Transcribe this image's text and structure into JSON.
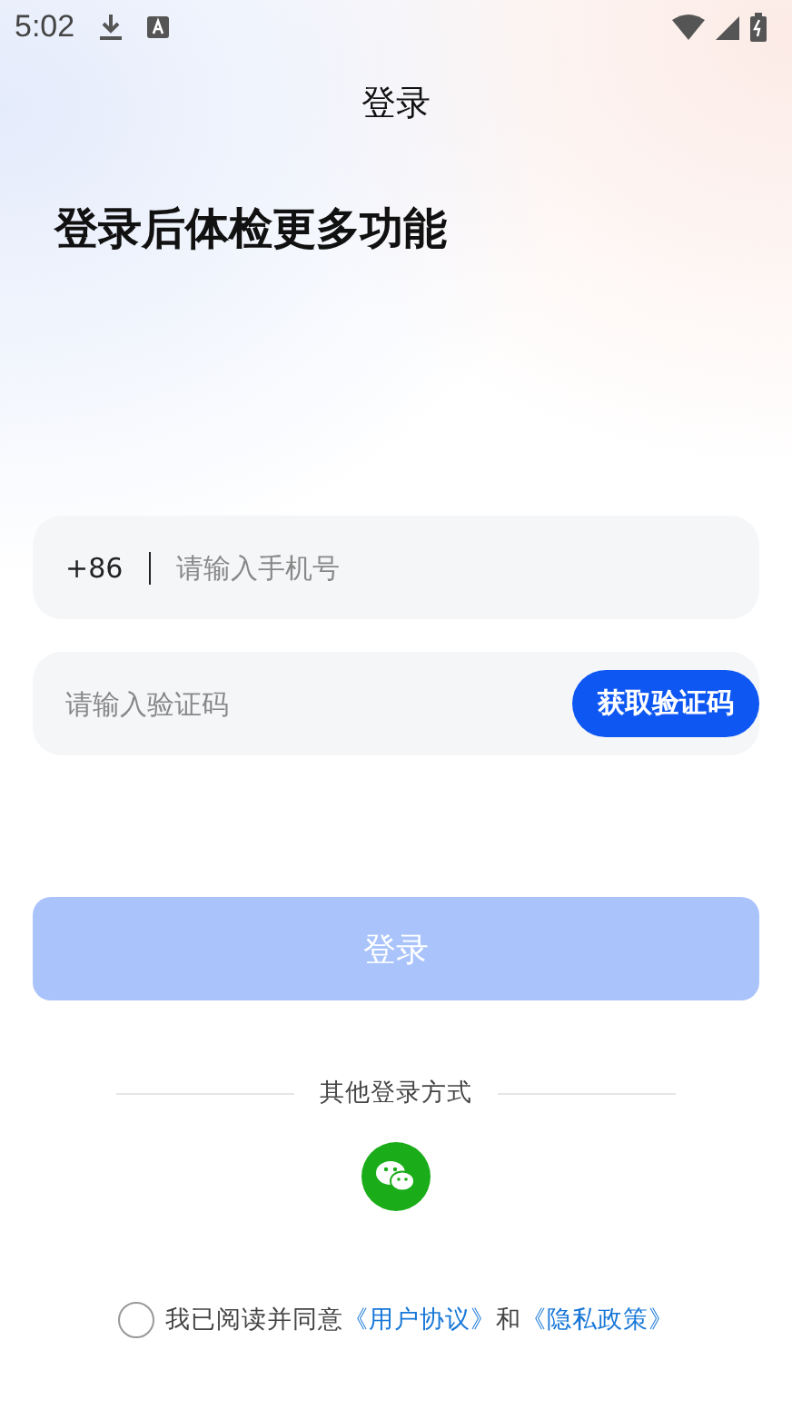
{
  "status_bar": {
    "time": "5:02"
  },
  "title": "登录",
  "heading": "登录后体检更多功能",
  "phone_field": {
    "country_code": "+86",
    "placeholder": "请输入手机号"
  },
  "code_field": {
    "placeholder": "请输入验证码",
    "button": "获取验证码"
  },
  "login_button": {
    "label": "登录",
    "disabled": true
  },
  "other_login": {
    "label": "其他登录方式"
  },
  "agreement": {
    "checked": false,
    "text": "我已阅读并同意",
    "links": [
      "《用户协议》",
      "《隐私政策》"
    ],
    "joiner": "和"
  }
}
